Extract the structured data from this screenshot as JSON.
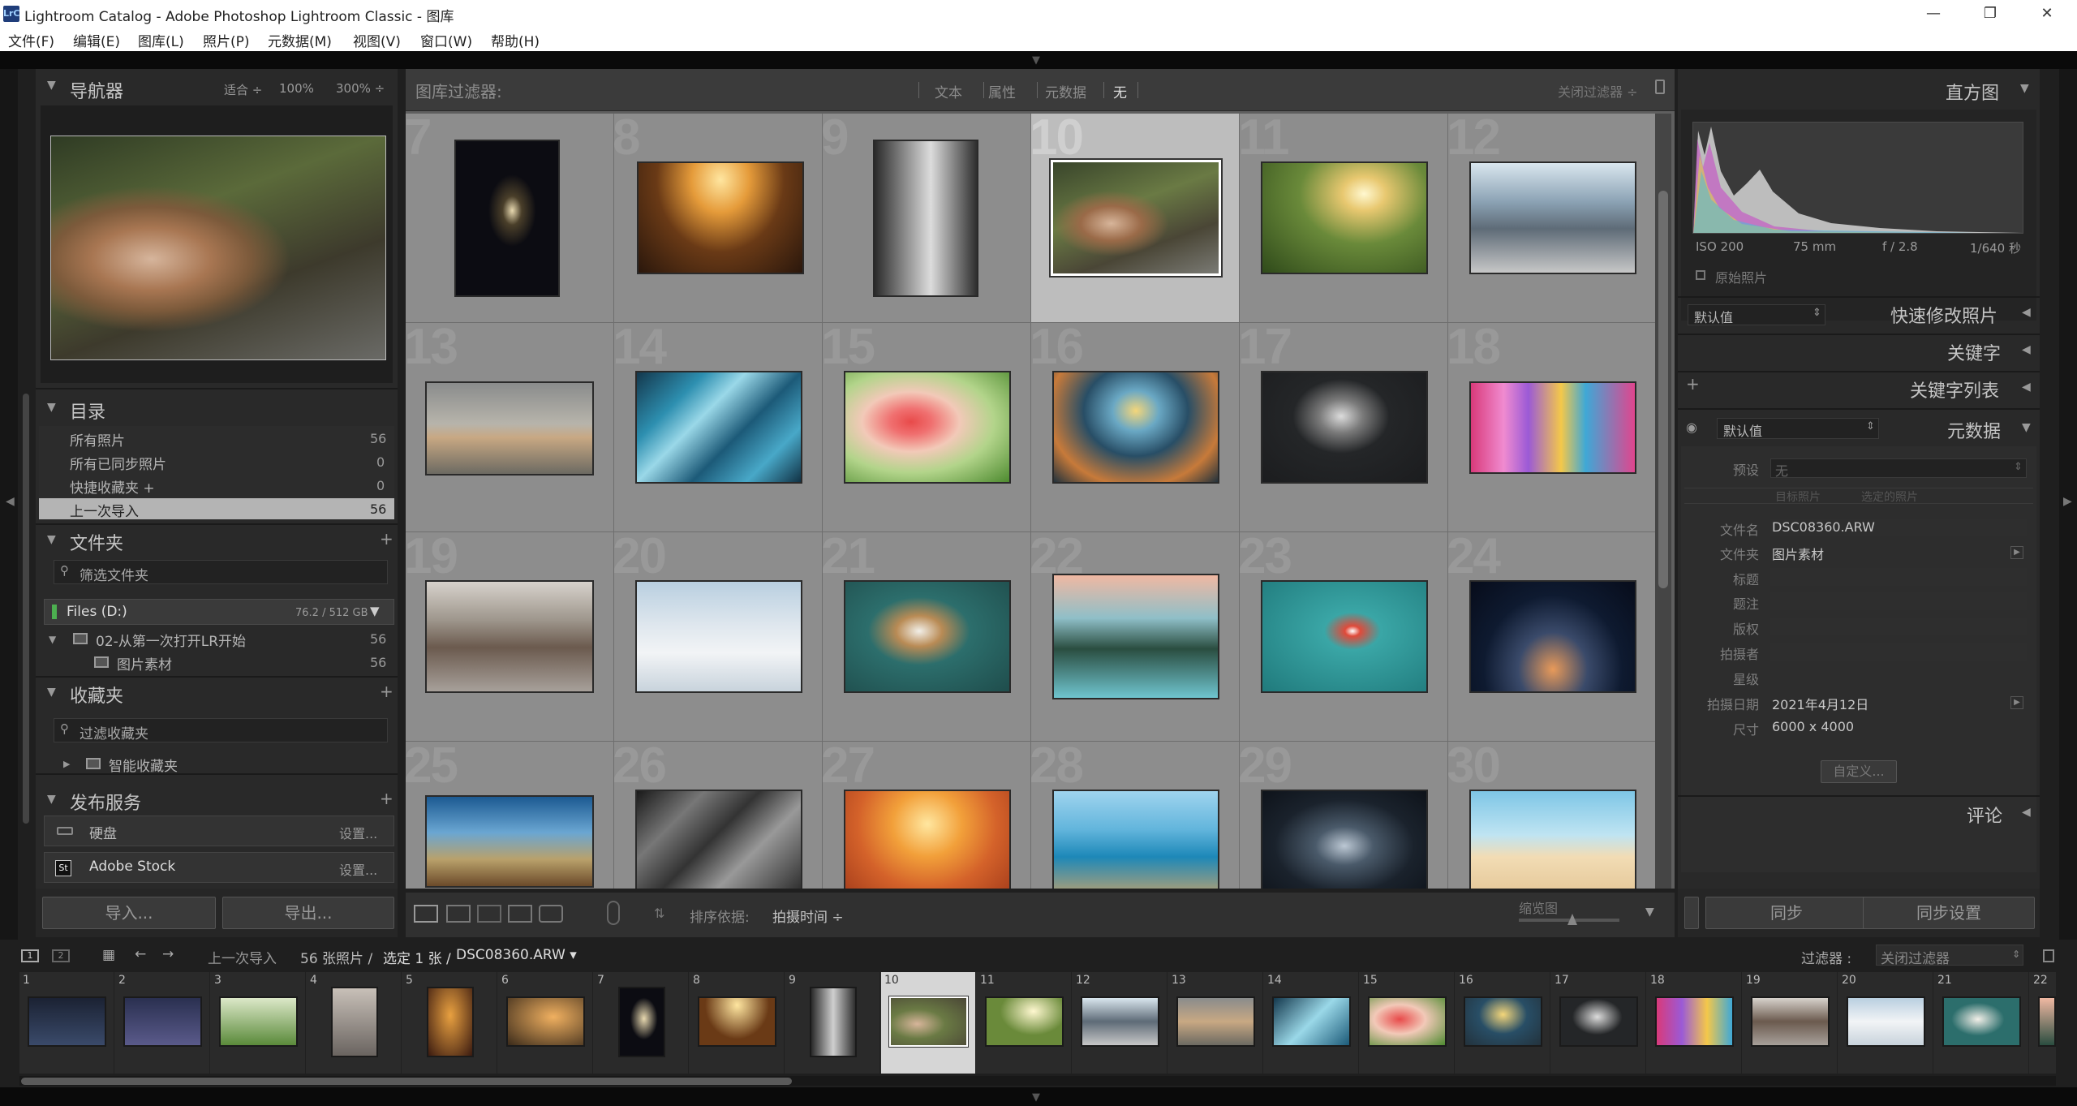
{
  "window": {
    "app_icon": "LrC",
    "title": "Lightroom Catalog - Adobe Photoshop Lightroom Classic - 图库",
    "controls": [
      "minimize-icon",
      "maximize-icon",
      "close-icon"
    ]
  },
  "menu": [
    "文件(F)",
    "编辑(E)",
    "图库(L)",
    "照片(P)",
    "元数据(M)",
    "视图(V)",
    "窗口(W)",
    "帮助(H)"
  ],
  "navigator": {
    "title": "导航器",
    "zoom": [
      "适合 ÷",
      "100%",
      "300% ÷"
    ]
  },
  "catalog": {
    "title": "目录",
    "rows": [
      {
        "label": "所有照片",
        "count": "56"
      },
      {
        "label": "所有已同步照片",
        "count": "0"
      },
      {
        "label": "快捷收藏夹 +",
        "count": "0"
      },
      {
        "label": "上一次导入",
        "count": "56"
      }
    ]
  },
  "folders": {
    "title": "文件夹",
    "filter_placeholder": "筛选文件夹",
    "volume": "Files (D:)",
    "volume_size": "76.2 / 512 GB",
    "items": [
      {
        "label": "02-从第一次打开LR开始",
        "count": "56"
      },
      {
        "label": "图片素材",
        "count": "56"
      }
    ]
  },
  "collections": {
    "title": "收藏夹",
    "filter_placeholder": "过滤收藏夹",
    "items": [
      "智能收藏夹"
    ]
  },
  "publish": {
    "title": "发布服务",
    "items": [
      {
        "label": "硬盘",
        "action": "设置..."
      },
      {
        "label": "Adobe Stock",
        "action": "设置..."
      }
    ]
  },
  "left_buttons": {
    "import": "导入...",
    "export": "导出..."
  },
  "filterbar": {
    "label": "图库过滤器:",
    "options": [
      "文本",
      "属性",
      "元数据",
      "无"
    ],
    "right": "关闭过滤器 ÷"
  },
  "grid": {
    "selected": "10"
  },
  "toolbar": {
    "sort_label": "排序依据:",
    "sort_value": "拍摄时间 ÷",
    "thumb_label": "缩览图"
  },
  "histogram": {
    "title": "直方图",
    "iso": "ISO 200",
    "focal": "75 mm",
    "aperture": "f / 2.8",
    "shutter": "1/640 秒",
    "original": "原始照片"
  },
  "quick_develop": {
    "preset": "默认值",
    "title": "快速修改照片"
  },
  "keywords": {
    "title": "关键字",
    "list_title": "关键字列表"
  },
  "metadata": {
    "preset": "默认值",
    "title": "元数据",
    "preset_label": "预设",
    "preset_value": "无",
    "tabs": [
      "目标照片",
      "选定的照片"
    ],
    "fields": [
      {
        "label": "文件名",
        "value": "DSC08360.ARW"
      },
      {
        "label": "文件夹",
        "value": "图片素材"
      },
      {
        "label": "标题",
        "value": ""
      },
      {
        "label": "题注",
        "value": ""
      },
      {
        "label": "版权",
        "value": ""
      },
      {
        "label": "拍摄者",
        "value": ""
      },
      {
        "label": "星级",
        "value": ""
      },
      {
        "label": "拍摄日期",
        "value": "2021年4月12日"
      },
      {
        "label": "尺寸",
        "value": "6000 x 4000"
      }
    ],
    "custom": "自定义..."
  },
  "comments": {
    "title": "评论"
  },
  "right_buttons": {
    "sync": "同步",
    "sync_settings": "同步设置"
  },
  "filmbar": {
    "source": "上一次导入",
    "count": "56 张照片 /",
    "selected": "选定 1 张 /",
    "filename": "DSC08360.ARW ▾",
    "filter_label": "过滤器 :",
    "filter_value": "关闭过滤器",
    "page1": "1",
    "page2": "2"
  }
}
